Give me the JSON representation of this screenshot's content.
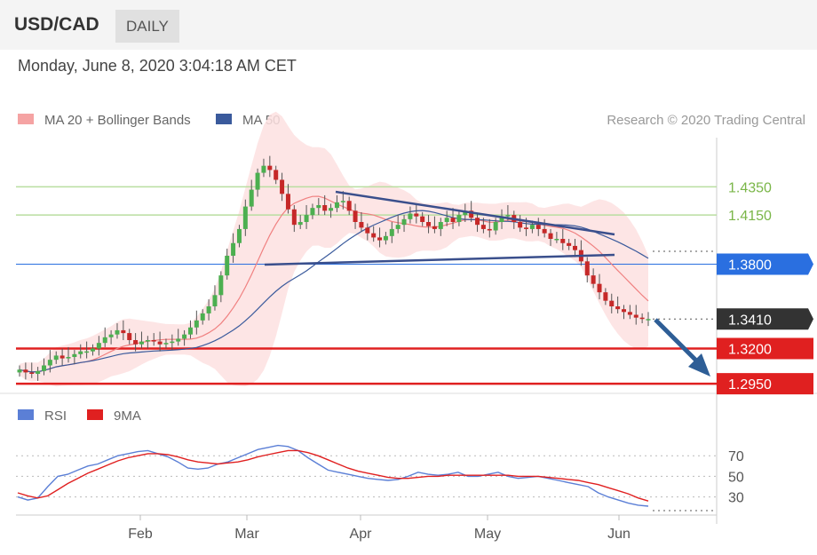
{
  "header": {
    "symbol": "USD/CAD",
    "period": "DAILY"
  },
  "timestamp": "Monday, June 8, 2020 3:04:18 AM CET",
  "legend": {
    "ma20": "MA 20 + Bollinger Bands",
    "ma50": "MA 50",
    "credit": "Research © 2020 Trading Central",
    "rsi": "RSI",
    "ma9": "9MA"
  },
  "colors": {
    "ma20": "#f08080",
    "ma50": "#3a5a9c",
    "bands": "#fde0e0",
    "resistance": "#7ab648",
    "pivot": "#2a6fe0",
    "support": "#e02020",
    "last": "#333333",
    "candle_up": "#4caf50",
    "candle_down": "#c62828",
    "rsi": "#5b7fd6",
    "rsi_ma": "#e02020"
  },
  "chart_data": [
    {
      "type": "candlestick",
      "series_names": [
        "MA 20 + Bollinger Bands",
        "MA 50"
      ],
      "x_labels": [
        "Feb",
        "Mar",
        "Apr",
        "May",
        "Jun"
      ],
      "ylim": [
        1.29,
        1.47
      ],
      "levels": [
        {
          "value": 1.435,
          "label": "1.4350",
          "kind": "resistance"
        },
        {
          "value": 1.415,
          "label": "1.4150",
          "kind": "resistance"
        },
        {
          "value": 1.38,
          "label": "1.3800",
          "kind": "pivot"
        },
        {
          "value": 1.341,
          "label": "1.3410",
          "kind": "last"
        },
        {
          "value": 1.32,
          "label": "1.3200",
          "kind": "support"
        },
        {
          "value": 1.295,
          "label": "1.2950",
          "kind": "support"
        }
      ],
      "close": [
        1.305,
        1.303,
        1.302,
        1.304,
        1.308,
        1.312,
        1.315,
        1.313,
        1.314,
        1.316,
        1.318,
        1.318,
        1.32,
        1.324,
        1.328,
        1.33,
        1.333,
        1.331,
        1.326,
        1.323,
        1.325,
        1.326,
        1.325,
        1.323,
        1.324,
        1.325,
        1.327,
        1.33,
        1.335,
        1.34,
        1.345,
        1.35,
        1.358,
        1.372,
        1.386,
        1.395,
        1.405,
        1.421,
        1.433,
        1.445,
        1.45,
        1.447,
        1.44,
        1.43,
        1.419,
        1.408,
        1.41,
        1.415,
        1.42,
        1.422,
        1.418,
        1.42,
        1.424,
        1.425,
        1.418,
        1.41,
        1.406,
        1.402,
        1.399,
        1.397,
        1.4,
        1.405,
        1.408,
        1.412,
        1.416,
        1.414,
        1.41,
        1.407,
        1.405,
        1.41,
        1.413,
        1.41,
        1.415,
        1.418,
        1.413,
        1.408,
        1.405,
        1.404,
        1.41,
        1.414,
        1.415,
        1.41,
        1.406,
        1.405,
        1.408,
        1.405,
        1.402,
        1.398,
        1.398,
        1.395,
        1.393,
        1.39,
        1.382,
        1.372,
        1.366,
        1.36,
        1.354,
        1.35,
        1.348,
        1.346,
        1.344,
        1.342,
        1.341,
        1.341
      ]
    },
    {
      "type": "line",
      "series": [
        {
          "name": "RSI",
          "values": [
            30,
            27,
            29,
            40,
            50,
            52,
            56,
            60,
            62,
            66,
            70,
            72,
            74,
            75,
            72,
            69,
            64,
            58,
            57,
            58,
            62,
            64,
            68,
            72,
            76,
            78,
            80,
            79,
            75,
            68,
            62,
            56,
            54,
            52,
            50,
            48,
            47,
            46,
            47,
            50,
            54,
            52,
            51,
            52,
            54,
            50,
            50,
            52,
            54,
            50,
            48,
            49,
            50,
            48,
            46,
            44,
            42,
            40,
            34,
            30,
            27,
            24,
            22,
            21
          ]
        },
        {
          "name": "9MA",
          "values": [
            34,
            31,
            29,
            31,
            37,
            43,
            48,
            53,
            57,
            61,
            65,
            68,
            70,
            72,
            72,
            71,
            69,
            66,
            64,
            63,
            62,
            63,
            64,
            66,
            69,
            71,
            73,
            75,
            75,
            73,
            70,
            66,
            62,
            58,
            55,
            53,
            51,
            49,
            48,
            48,
            49,
            50,
            50,
            51,
            51,
            51,
            51,
            51,
            51,
            51,
            50,
            50,
            50,
            49,
            48,
            47,
            46,
            44,
            42,
            39,
            36,
            33,
            29,
            26
          ]
        }
      ],
      "yticks": [
        "70",
        "50",
        "30"
      ],
      "x_labels": [
        "Feb",
        "Mar",
        "Apr",
        "May",
        "Jun"
      ],
      "ylim": [
        15,
        90
      ]
    }
  ]
}
